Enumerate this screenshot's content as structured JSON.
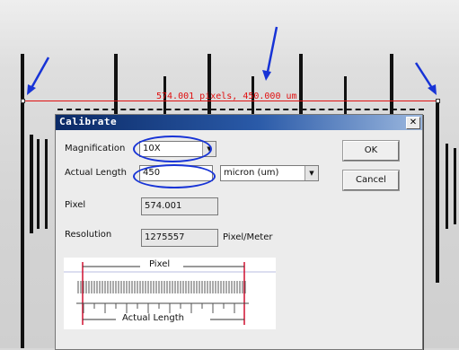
{
  "measurement": {
    "text": "574.001 pixels, 450.000 um"
  },
  "dialog": {
    "title": "Calibrate",
    "close_label": "✕",
    "magnification_label": "Magnification",
    "magnification_value": "10X",
    "actual_length_label": "Actual Length",
    "actual_length_value": "450",
    "unit_value": "micron (um)",
    "pixel_label": "Pixel",
    "pixel_value": "574.001",
    "resolution_label": "Resolution",
    "resolution_value": "1275557",
    "resolution_unit": "Pixel/Meter",
    "ok_label": "OK",
    "cancel_label": "Cancel",
    "diagram": {
      "pixel_label": "Pixel",
      "actual_length_label": "Actual Length"
    }
  },
  "colors": {
    "annotation": "#1733d6",
    "measure_line": "#e01010",
    "title_bar": "#0b2a66"
  }
}
